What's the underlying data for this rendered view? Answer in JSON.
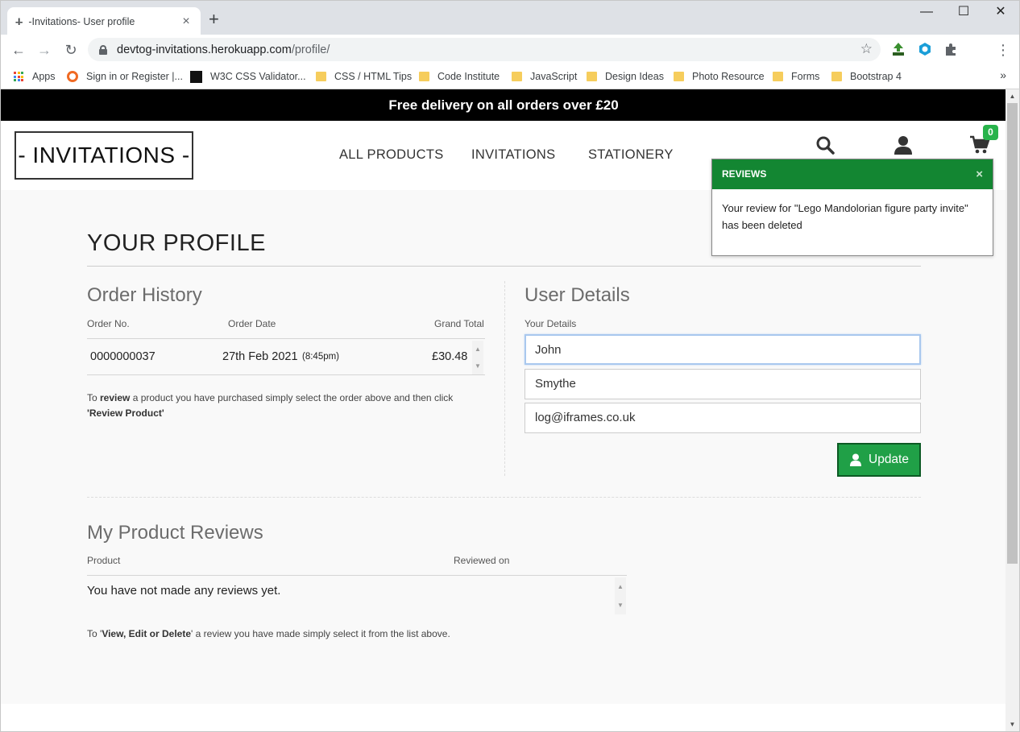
{
  "browser": {
    "tab_favicon": "-I-",
    "tab_title": "-Invitations- User profile",
    "tab_close": "×",
    "new_tab": "+",
    "window_controls": [
      "—",
      "☐",
      "✕"
    ],
    "url_domain": "devtog-invitations.herokuapp.com",
    "url_path": "/profile/",
    "bookmarks": [
      {
        "label": "Apps",
        "icon": "apps-grid-icon"
      },
      {
        "label": "Sign in or Register |...",
        "icon": "ring-icon"
      },
      {
        "label": "W3C CSS Validator...",
        "icon": "w3c-icon"
      },
      {
        "label": "CSS / HTML Tips",
        "icon": "folder-icon"
      },
      {
        "label": "Code Institute",
        "icon": "folder-icon"
      },
      {
        "label": "JavaScript",
        "icon": "folder-icon"
      },
      {
        "label": "Design Ideas",
        "icon": "folder-icon"
      },
      {
        "label": "Photo Resource",
        "icon": "folder-icon"
      },
      {
        "label": "Forms",
        "icon": "folder-icon"
      },
      {
        "label": "Bootstrap 4",
        "icon": "folder-icon"
      }
    ],
    "bookmarks_more": "»"
  },
  "site": {
    "banner": "Free delivery on all orders over £20",
    "logo": "- INVITATIONS -",
    "nav": [
      "ALL PRODUCTS",
      "INVITATIONS",
      "STATIONERY"
    ],
    "cart_count": "0",
    "accent_color": "#138632"
  },
  "toast": {
    "title": "REVIEWS",
    "close": "×",
    "message": "Your review for \"Lego Mandolorian figure party invite\" has been deleted"
  },
  "profile": {
    "title": "YOUR PROFILE",
    "order_history": {
      "title": "Order History",
      "columns": [
        "Order No.",
        "Order Date",
        "Grand Total"
      ],
      "rows": [
        {
          "order_no": "0000000037",
          "date": "27th Feb 2021",
          "time": "(8:45pm)",
          "total": "£30.48"
        }
      ],
      "note_prefix": "To ",
      "note_bold1": "review",
      "note_middle": " a product you have purchased simply select the order above and then click ",
      "note_bold2": "'Review Product'"
    },
    "user_details": {
      "title": "User Details",
      "label": "Your Details",
      "first_name": "John",
      "last_name": "Smythe",
      "email": "log@iframes.co.uk",
      "update_label": "Update"
    },
    "reviews": {
      "title": "My Product Reviews",
      "columns": [
        "Product",
        "Reviewed on"
      ],
      "empty": "You have not made any reviews yet.",
      "note_prefix": "To '",
      "note_bold": "View, Edit or Delete",
      "note_suffix": "' a review you have made simply select it from the list above."
    }
  }
}
